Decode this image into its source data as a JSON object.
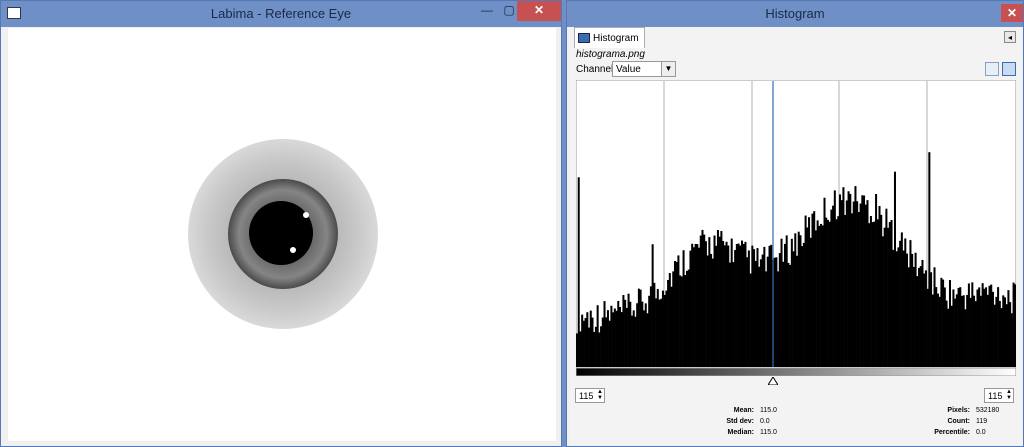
{
  "left_window": {
    "title": "Labima - Reference Eye",
    "minimize": "—",
    "maximize": "▢",
    "close": "✕"
  },
  "right_window": {
    "title": "Histogram",
    "close": "✕",
    "tab_label": "Histogram",
    "filename": "histograma.png",
    "channel_label": "Channel:",
    "channel_value": "Value",
    "left_value": "115",
    "right_value": "115",
    "stats_left": [
      {
        "label": "Mean:",
        "value": "115.0"
      },
      {
        "label": "Std dev:",
        "value": "0.0"
      },
      {
        "label": "Median:",
        "value": "115.0"
      }
    ],
    "stats_right": [
      {
        "label": "Pixels:",
        "value": "532180"
      },
      {
        "label": "Count:",
        "value": "119"
      },
      {
        "label": "Percentile:",
        "value": "0.0"
      }
    ],
    "histogram": {
      "marker_value": 115
    }
  }
}
